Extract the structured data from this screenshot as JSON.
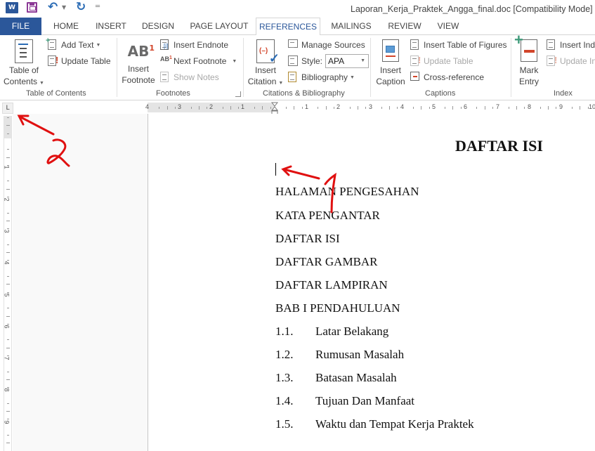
{
  "app": {
    "window_title": "Laporan_Kerja_Praktek_Angga_final.doc [Compatibility Mode] - W",
    "quick_access": [
      "word-icon",
      "save-icon",
      "undo-icon",
      "redo-icon",
      "customize-icon"
    ]
  },
  "tabs": [
    {
      "label": "FILE"
    },
    {
      "label": "HOME"
    },
    {
      "label": "INSERT"
    },
    {
      "label": "DESIGN"
    },
    {
      "label": "PAGE LAYOUT"
    },
    {
      "label": "REFERENCES",
      "active": true
    },
    {
      "label": "MAILINGS"
    },
    {
      "label": "REVIEW"
    },
    {
      "label": "VIEW"
    }
  ],
  "ribbon": {
    "toc_group": {
      "label": "Table of Contents",
      "toc_button": [
        "Table of",
        "Contents"
      ],
      "add_text": "Add Text",
      "update_table": "Update Table"
    },
    "footnotes_group": {
      "label": "Footnotes",
      "insert_footnote": [
        "Insert",
        "Footnote"
      ],
      "ab_glyph": "AB",
      "ab_sup": "1",
      "insert_endnote": "Insert Endnote",
      "next_footnote": "Next Footnote",
      "show_notes": "Show Notes"
    },
    "citations_group": {
      "label": "Citations & Bibliography",
      "insert_citation": [
        "Insert",
        "Citation"
      ],
      "manage_sources": "Manage Sources",
      "style_label": "Style:",
      "style_value": "APA",
      "bibliography": "Bibliography"
    },
    "captions_group": {
      "label": "Captions",
      "insert_caption": [
        "Insert",
        "Caption"
      ],
      "insert_table_of_figures": "Insert Table of Figures",
      "update_table": "Update Table",
      "cross_reference": "Cross-reference"
    },
    "index_group": {
      "label": "Index",
      "mark_entry": [
        "Mark",
        "Entry"
      ],
      "insert_index": "Insert Inde",
      "update_index": "Update In"
    }
  },
  "ruler": {
    "horizontal_left": [
      "4",
      "3",
      "2",
      "1"
    ],
    "horizontal_right": [
      "1",
      "2",
      "3",
      "4",
      "5",
      "6",
      "7",
      "8",
      "9",
      "10"
    ],
    "vertical": [
      "1",
      "2",
      "3",
      "4",
      "5",
      "6",
      "7",
      "8",
      "9"
    ],
    "tab_selector": "L"
  },
  "document": {
    "title": "DAFTAR ISI",
    "entries": [
      "HALAMAN PENGESAHAN",
      "KATA PENGANTAR",
      "DAFTAR ISI",
      "DAFTAR GAMBAR",
      "DAFTAR LAMPIRAN",
      "BAB I PENDAHULUAN"
    ],
    "sub_entries": [
      {
        "num": "1.1.",
        "text": "Latar Belakang"
      },
      {
        "num": "1.2.",
        "text": "Rumusan Masalah"
      },
      {
        "num": "1.3.",
        "text": "Batasan Masalah"
      },
      {
        "num": "1.4.",
        "text": "Tujuan Dan Manfaat"
      },
      {
        "num": "1.5.",
        "text": "Waktu dan Tempat Kerja Praktek"
      }
    ]
  },
  "annotations": [
    {
      "label": "1",
      "color": "#e01010"
    },
    {
      "label": "2",
      "color": "#e01010"
    }
  ],
  "colors": {
    "accent": "#2b579a",
    "annotation": "#e01010"
  }
}
